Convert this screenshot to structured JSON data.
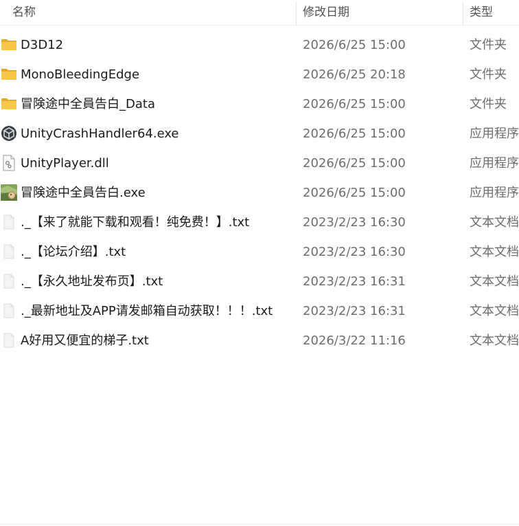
{
  "columns": {
    "name": "名称",
    "date": "修改日期",
    "type": "类型"
  },
  "files": [
    {
      "name": "D3D12",
      "date": "2026/6/25 15:00",
      "type": "文件夹",
      "icon": "folder-icon"
    },
    {
      "name": "MonoBleedingEdge",
      "date": "2026/6/25 20:18",
      "type": "文件夹",
      "icon": "folder-icon"
    },
    {
      "name": "冒険途中全員告白_Data",
      "date": "2026/6/25 15:00",
      "type": "文件夹",
      "icon": "folder-icon"
    },
    {
      "name": "UnityCrashHandler64.exe",
      "date": "2026/6/25 15:00",
      "type": "应用程序",
      "icon": "unity-icon"
    },
    {
      "name": "UnityPlayer.dll",
      "date": "2026/6/25 15:00",
      "type": "应用程序",
      "icon": "dll-gear-icon"
    },
    {
      "name": "冒険途中全員告白.exe",
      "date": "2026/6/25 15:00",
      "type": "应用程序",
      "icon": "game-app-icon"
    },
    {
      "name": "._【来了就能下载和观看！纯免费！】.txt",
      "date": "2023/2/23 16:30",
      "type": "文本文档",
      "icon": "text-file-icon"
    },
    {
      "name": "._【论坛介绍】.txt",
      "date": "2023/2/23 16:30",
      "type": "文本文档",
      "icon": "text-file-icon"
    },
    {
      "name": "._【永久地址发布页】.txt",
      "date": "2023/2/23 16:31",
      "type": "文本文档",
      "icon": "text-file-icon"
    },
    {
      "name": "._最新地址及APP请发邮箱自动获取！！！.txt",
      "date": "2023/2/23 16:31",
      "type": "文本文档",
      "icon": "text-file-icon"
    },
    {
      "name": "A好用又便宜的梯子.txt",
      "date": "2026/3/22 11:16",
      "type": "文本文档",
      "icon": "text-file-icon"
    }
  ],
  "colors": {
    "folder": "#f8c74a",
    "folder_dark": "#e6a928",
    "text_primary": "#1a1a1a",
    "text_secondary": "#6d6d6d"
  }
}
